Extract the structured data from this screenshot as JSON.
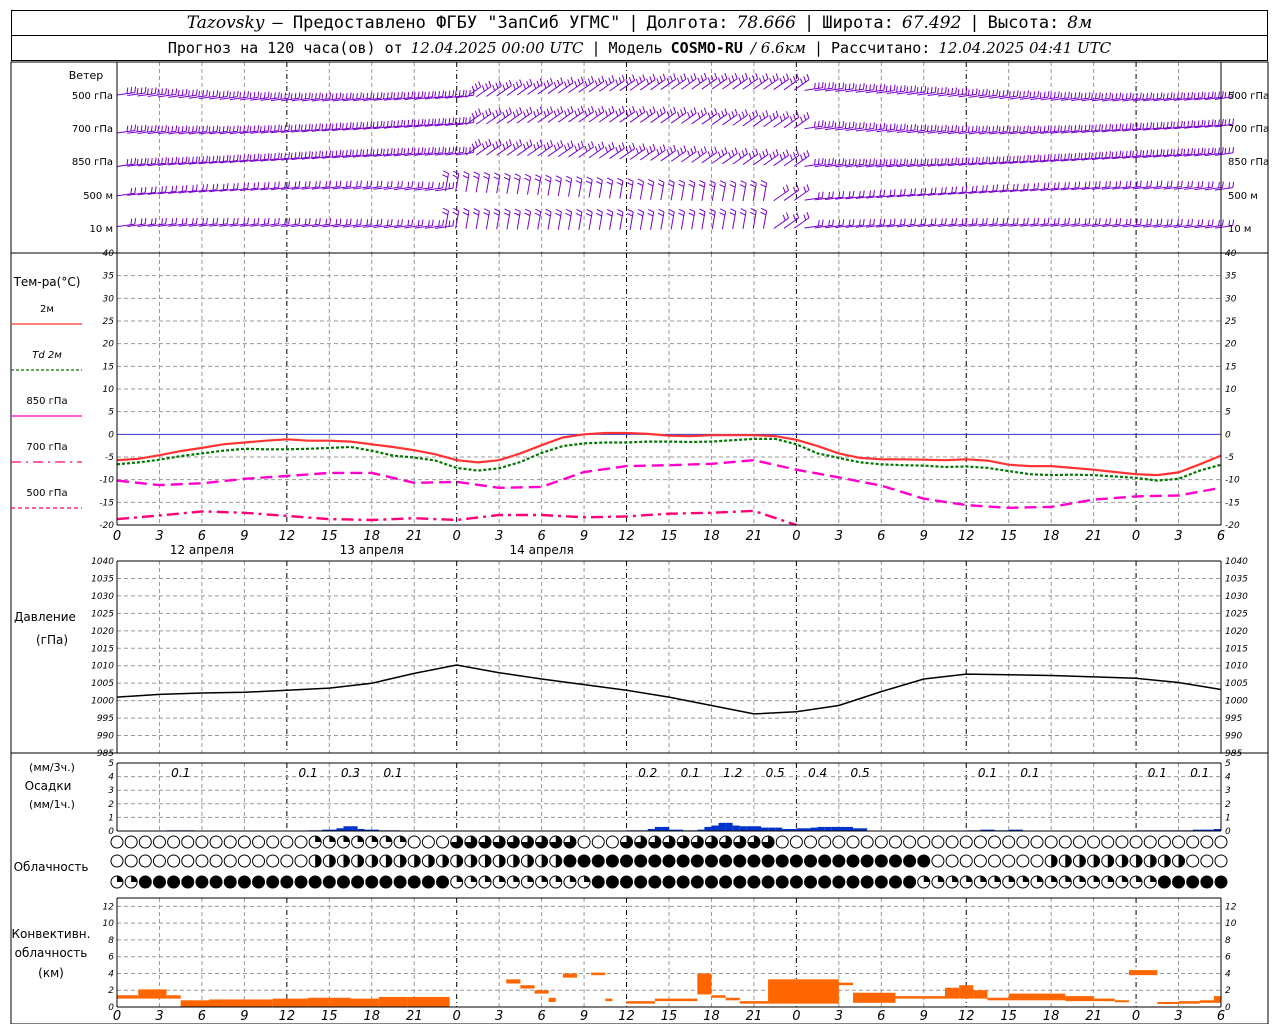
{
  "header": {
    "station": "Tazovsky",
    "provider": "— Предоставлено ФГБУ \"ЗапСиб УГМС\"",
    "lon_label": "Долгота:",
    "lon": "78.666",
    "lat_label": "Широта:",
    "lat": "67.492",
    "alt_label": "Высота:",
    "alt": "8м",
    "forecast_label": "Прогноз на 120 часа(ов) от",
    "forecast_start": "12.04.2025 00:00 UTC",
    "model_label": "Модель",
    "model": "COSMO-RU",
    "resolution": "/ 6.6км",
    "calc_label": "Рассчитано:",
    "calc_time": "12.04.2025 04:41 UTC"
  },
  "labels": {
    "wind": "Ветер",
    "wind_levels": [
      "500 гПа",
      "700 гПа",
      "850 гПа",
      "500 м",
      "10  м"
    ],
    "temp_title": "Тем-ра(°C)",
    "legend": [
      "2м",
      "Td  2м",
      "850 гПа",
      "700 гПа",
      "500 гПа"
    ],
    "pressure_title": "Давление",
    "pressure_unit": "(гПа)",
    "precip_unit_top": "(мм/3ч.)",
    "precip_title": "Осадки",
    "precip_unit_bottom": "(мм/1ч.)",
    "cloud_title": "Облачность",
    "conv_title_1": "Конвективн.",
    "conv_title_2": "облачность",
    "conv_unit": "(км)"
  },
  "colors": {
    "t2m": "#ff3333",
    "td2m": "#007700",
    "t850": "#ff00cc",
    "t700": "#ff0077",
    "t500": "#ff0066",
    "wind": "#7700cc",
    "precip": "#0033cc",
    "conv": "#ff6600",
    "grid": "#999999"
  },
  "chart_data": [
    {
      "type": "line",
      "title": "Тем-ра(°C)",
      "x_ticks": [
        "0",
        "3",
        "6",
        "9",
        "12",
        "15",
        "18",
        "21",
        "0",
        "3",
        "6",
        "9",
        "12",
        "15",
        "18",
        "21",
        "0",
        "3",
        "6",
        "9",
        "12",
        "15",
        "18",
        "21",
        "0",
        "3",
        "6"
      ],
      "day_labels": [
        "12 апреля",
        "13 апреля",
        "14 апреля"
      ],
      "x_hours": [
        0,
        6,
        12,
        18,
        24,
        30,
        36,
        42,
        48,
        54,
        60,
        66,
        72,
        78,
        84,
        90,
        96,
        102,
        108,
        114,
        120,
        126,
        132,
        138,
        144,
        150,
        156
      ],
      "ylim": [
        -20,
        40
      ],
      "yticks": [
        -20,
        -15,
        -10,
        -5,
        0,
        5,
        10,
        15,
        20,
        25,
        30,
        35,
        40
      ],
      "series": [
        {
          "name": "2м",
          "x": [
            0,
            3,
            6,
            9,
            12,
            15,
            18,
            21,
            24,
            27,
            30,
            33,
            36,
            39,
            42,
            45,
            48,
            51,
            54,
            57,
            60,
            63,
            66,
            69,
            72,
            75,
            78,
            81,
            84,
            87,
            90,
            93,
            96,
            99,
            102,
            105,
            108,
            111,
            114,
            117,
            120,
            123,
            126,
            129,
            132,
            135,
            138,
            141,
            144,
            147,
            150,
            153,
            156
          ],
          "values": [
            -5.7,
            -5.4,
            -4.6,
            -3.7,
            -3.0,
            -2.2,
            -1.8,
            -1.4,
            -1.1,
            -1.4,
            -1.4,
            -1.6,
            -2.2,
            -2.8,
            -3.5,
            -4.4,
            -5.7,
            -6.2,
            -5.7,
            -4.2,
            -2.4,
            -0.7,
            0.0,
            0.3,
            0.3,
            0.1,
            -0.3,
            -0.4,
            -0.2,
            -0.2,
            -0.2,
            -0.4,
            -1.2,
            -2.6,
            -4.2,
            -5.2,
            -5.5,
            -5.5,
            -5.6,
            -5.7,
            -5.5,
            -5.8,
            -6.7,
            -7.0,
            -7.0,
            -7.4,
            -7.8,
            -8.3,
            -8.8,
            -9.0,
            -8.4,
            -6.6,
            -4.7
          ]
        },
        {
          "name": "Td 2м",
          "x": [
            0,
            3,
            6,
            9,
            12,
            15,
            18,
            21,
            24,
            27,
            30,
            33,
            36,
            39,
            42,
            45,
            48,
            51,
            54,
            57,
            60,
            63,
            66,
            69,
            72,
            75,
            78,
            81,
            84,
            87,
            90,
            93,
            96,
            99,
            102,
            105,
            108,
            111,
            114,
            117,
            120,
            123,
            126,
            129,
            132,
            135,
            138,
            141,
            144,
            147,
            150,
            153,
            156
          ],
          "values": [
            -6.6,
            -6.2,
            -5.6,
            -4.8,
            -4.2,
            -3.6,
            -3.2,
            -3.3,
            -3.3,
            -3.2,
            -3.0,
            -2.8,
            -3.6,
            -4.7,
            -5.1,
            -5.8,
            -7.4,
            -8.0,
            -7.5,
            -6.1,
            -4.1,
            -2.6,
            -2.0,
            -1.8,
            -1.8,
            -1.6,
            -1.6,
            -1.7,
            -1.6,
            -1.3,
            -1.0,
            -1.0,
            -2.2,
            -4.2,
            -5.2,
            -6.2,
            -6.6,
            -6.8,
            -6.9,
            -7.2,
            -7.1,
            -7.4,
            -8.1,
            -8.8,
            -9.0,
            -8.9,
            -9.0,
            -9.3,
            -9.6,
            -10.2,
            -9.8,
            -8.0,
            -6.7
          ]
        },
        {
          "name": "850 гПа",
          "x": [
            0,
            6,
            12,
            18,
            24,
            30,
            36,
            42,
            48,
            54,
            60,
            66,
            72,
            78,
            84,
            90,
            96,
            102,
            108,
            114,
            120,
            126,
            132,
            138,
            144,
            150,
            156
          ],
          "values": [
            -10.2,
            -11.2,
            -10.8,
            -9.8,
            -9.2,
            -8.5,
            -8.5,
            -10.7,
            -10.5,
            -11.8,
            -11.6,
            -8.3,
            -7.0,
            -6.8,
            -6.5,
            -5.7,
            -7.8,
            -9.5,
            -11.3,
            -14.2,
            -15.6,
            -16.2,
            -16.0,
            -14.4,
            -13.7,
            -13.5,
            -11.8
          ]
        },
        {
          "name": "700 гПа",
          "x": [
            0,
            6,
            12,
            18,
            24,
            30,
            36,
            42,
            48,
            54,
            60,
            66,
            72,
            78,
            84,
            90,
            96,
            102,
            108,
            114,
            120,
            126,
            132,
            138,
            144,
            150,
            156
          ],
          "values": [
            -18.7,
            -17.9,
            -17.0,
            -17.3,
            -18.0,
            -18.7,
            -18.9,
            -18.5,
            -18.9,
            -17.8,
            -17.8,
            -18.3,
            -18.1,
            -17.5,
            -17.3,
            -16.9,
            -20.0,
            null,
            null,
            null,
            null,
            null,
            null,
            null,
            null,
            null,
            null
          ]
        }
      ]
    },
    {
      "type": "line",
      "title": "Давление",
      "ylabel": "(гПа)",
      "ylim": [
        985,
        1040
      ],
      "yticks": [
        985,
        990,
        995,
        1000,
        1005,
        1010,
        1015,
        1020,
        1025,
        1030,
        1035,
        1040
      ],
      "x": [
        0,
        6,
        12,
        18,
        24,
        30,
        36,
        42,
        48,
        54,
        60,
        66,
        72,
        78,
        84,
        90,
        96,
        102,
        108,
        114,
        120,
        126,
        132,
        138,
        144,
        150,
        156
      ],
      "values": [
        1001.0,
        1001.8,
        1002.2,
        1002.4,
        1003.0,
        1003.6,
        1005.0,
        1007.8,
        1010.2,
        1008.0,
        1006.2,
        1004.6,
        1003.0,
        1001.0,
        998.6,
        996.2,
        996.8,
        998.6,
        1002.6,
        1006.2,
        1007.6,
        1007.4,
        1007.2,
        1006.8,
        1006.4,
        1005.2,
        1003.2
      ]
    },
    {
      "type": "bar",
      "title": "Осадки",
      "ylim": [
        0,
        5
      ],
      "yticks": [
        0,
        1,
        2,
        3,
        4,
        5
      ],
      "amounts_3h": [
        {
          "hour": 9,
          "label": "0.1"
        },
        {
          "hour": 27,
          "label": "0.1"
        },
        {
          "hour": 33,
          "label": "0.3"
        },
        {
          "hour": 39,
          "label": "0.1"
        },
        {
          "hour": 75,
          "label": "0.2"
        },
        {
          "hour": 81,
          "label": "0.1"
        },
        {
          "hour": 87,
          "label": "1.2"
        },
        {
          "hour": 93,
          "label": "0.5"
        },
        {
          "hour": 99,
          "label": "0.4"
        },
        {
          "hour": 105,
          "label": "0.5"
        },
        {
          "hour": 123,
          "label": "0.1"
        },
        {
          "hour": 129,
          "label": "0.1"
        },
        {
          "hour": 147,
          "label": "0.1"
        },
        {
          "hour": 153,
          "label": "0.1"
        }
      ],
      "hourly_x": [
        8,
        9,
        10,
        11,
        28,
        29,
        30,
        31,
        32,
        33,
        34,
        35,
        36,
        37,
        38,
        39,
        40,
        73,
        74,
        75,
        76,
        77,
        78,
        79,
        80,
        81,
        82,
        83,
        84,
        85,
        86,
        87,
        88,
        89,
        90,
        91,
        92,
        93,
        94,
        95,
        96,
        97,
        98,
        99,
        100,
        101,
        102,
        103,
        104,
        105,
        106,
        121,
        122,
        123,
        124,
        125,
        126,
        127,
        128,
        145,
        146,
        147,
        148,
        149,
        150,
        151,
        152,
        153,
        154,
        155,
        156
      ],
      "hourly_values": [
        0.05,
        0.05,
        0.05,
        0.05,
        0.05,
        0.05,
        0.1,
        0.1,
        0.2,
        0.35,
        0.35,
        0.15,
        0.1,
        0.1,
        0.05,
        0.05,
        0.05,
        0.05,
        0.05,
        0.05,
        0.15,
        0.3,
        0.3,
        0.1,
        0.1,
        0.05,
        0.05,
        0.1,
        0.3,
        0.4,
        0.6,
        0.6,
        0.4,
        0.35,
        0.35,
        0.35,
        0.25,
        0.25,
        0.25,
        0.15,
        0.15,
        0.2,
        0.2,
        0.25,
        0.3,
        0.3,
        0.3,
        0.3,
        0.3,
        0.2,
        0.2,
        0.05,
        0.05,
        0.1,
        0.1,
        0.05,
        0.05,
        0.1,
        0.1,
        0.05,
        0.05,
        0.05,
        0.05,
        0.05,
        0.05,
        0.05,
        0.05,
        0.1,
        0.1,
        0.1,
        0.15
      ]
    },
    {
      "type": "bar",
      "title": "Конвективн. облачность",
      "ylabel": "(км)",
      "ylim": [
        0,
        13
      ],
      "yticks": [
        0,
        2,
        4,
        6,
        8,
        10,
        12
      ],
      "bars": [
        {
          "x0": 0,
          "x1": 3,
          "base": 1.0,
          "top": 1.4
        },
        {
          "x0": 3,
          "x1": 7,
          "base": 1.0,
          "top": 2.1
        },
        {
          "x0": 7,
          "x1": 9,
          "base": 1.0,
          "top": 1.4
        },
        {
          "x0": 9,
          "x1": 13,
          "base": 0.0,
          "top": 0.8
        },
        {
          "x0": 13,
          "x1": 22,
          "base": 0.0,
          "top": 0.9
        },
        {
          "x0": 22,
          "x1": 27,
          "base": 0.0,
          "top": 1.0
        },
        {
          "x0": 27,
          "x1": 30,
          "base": 0.0,
          "top": 1.1
        },
        {
          "x0": 30,
          "x1": 33,
          "base": 0.0,
          "top": 1.1
        },
        {
          "x0": 33,
          "x1": 37,
          "base": 0.0,
          "top": 1.0
        },
        {
          "x0": 37,
          "x1": 41,
          "base": 0.0,
          "top": 1.2
        },
        {
          "x0": 41,
          "x1": 47,
          "base": 0.0,
          "top": 1.2
        },
        {
          "x0": 55,
          "x1": 57,
          "base": 2.8,
          "top": 3.3
        },
        {
          "x0": 57,
          "x1": 59,
          "base": 2.2,
          "top": 2.6
        },
        {
          "x0": 59,
          "x1": 61,
          "base": 1.6,
          "top": 2.0
        },
        {
          "x0": 61,
          "x1": 62,
          "base": 0.6,
          "top": 1.1
        },
        {
          "x0": 63,
          "x1": 65,
          "base": 3.5,
          "top": 4.0
        },
        {
          "x0": 67,
          "x1": 69,
          "base": 3.8,
          "top": 4.1
        },
        {
          "x0": 69,
          "x1": 70,
          "base": 0.7,
          "top": 1.0
        },
        {
          "x0": 72,
          "x1": 76,
          "base": 0.4,
          "top": 0.7
        },
        {
          "x0": 76,
          "x1": 78,
          "base": 0.7,
          "top": 1.0
        },
        {
          "x0": 78,
          "x1": 80,
          "base": 0.7,
          "top": 1.0
        },
        {
          "x0": 80,
          "x1": 82,
          "base": 0.7,
          "top": 1.0
        },
        {
          "x0": 82,
          "x1": 84,
          "base": 1.5,
          "top": 4.0
        },
        {
          "x0": 84,
          "x1": 86,
          "base": 1.1,
          "top": 1.4
        },
        {
          "x0": 86,
          "x1": 88,
          "base": 0.8,
          "top": 1.1
        },
        {
          "x0": 88,
          "x1": 90,
          "base": 0.4,
          "top": 0.7
        },
        {
          "x0": 90,
          "x1": 92,
          "base": 0.4,
          "top": 0.7
        },
        {
          "x0": 92,
          "x1": 102,
          "base": 0.4,
          "top": 3.3
        },
        {
          "x0": 102,
          "x1": 104,
          "base": 2.6,
          "top": 2.9
        },
        {
          "x0": 104,
          "x1": 110,
          "base": 0.5,
          "top": 1.7
        },
        {
          "x0": 110,
          "x1": 114,
          "base": 1.0,
          "top": 1.3
        },
        {
          "x0": 114,
          "x1": 117,
          "base": 1.0,
          "top": 1.3
        },
        {
          "x0": 117,
          "x1": 119,
          "base": 1.0,
          "top": 2.3
        },
        {
          "x0": 119,
          "x1": 121,
          "base": 1.0,
          "top": 2.6
        },
        {
          "x0": 121,
          "x1": 123,
          "base": 1.0,
          "top": 2.0
        },
        {
          "x0": 123,
          "x1": 126,
          "base": 0.8,
          "top": 1.1
        },
        {
          "x0": 126,
          "x1": 130,
          "base": 0.8,
          "top": 1.6
        },
        {
          "x0": 130,
          "x1": 134,
          "base": 0.8,
          "top": 1.6
        },
        {
          "x0": 134,
          "x1": 138,
          "base": 0.7,
          "top": 1.3
        },
        {
          "x0": 138,
          "x1": 141,
          "base": 0.7,
          "top": 1.0
        },
        {
          "x0": 141,
          "x1": 143,
          "base": 0.7,
          "top": 0.8
        },
        {
          "x0": 143,
          "x1": 147,
          "base": 3.8,
          "top": 4.4
        },
        {
          "x0": 147,
          "x1": 150,
          "base": 0.4,
          "top": 0.6
        },
        {
          "x0": 150,
          "x1": 153,
          "base": 0.4,
          "top": 0.7
        },
        {
          "x0": 153,
          "x1": 155,
          "base": 0.5,
          "top": 0.8
        },
        {
          "x0": 155,
          "x1": 156,
          "base": 0.5,
          "top": 1.3
        }
      ]
    }
  ]
}
